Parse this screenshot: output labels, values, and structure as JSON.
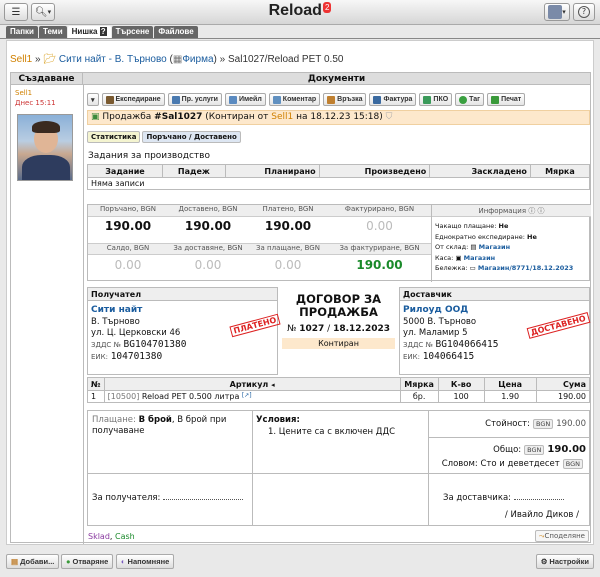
{
  "app": {
    "title": "Reload",
    "notification_count": "2"
  },
  "tabs": [
    {
      "label": "Папки"
    },
    {
      "label": "Теми"
    },
    {
      "label": "Нишка"
    },
    {
      "label": "?"
    },
    {
      "label": "Търсене"
    },
    {
      "label": "Файлове"
    }
  ],
  "breadcrumb": {
    "root": "Sell1",
    "sep1": "»",
    "company": "Сити найт - В. Търново",
    "company_type": "Фирма",
    "sep2": "»",
    "current": "Sal1027/Reload PET 0.50"
  },
  "columns": {
    "creator": "Създаване",
    "documents": "Документи"
  },
  "creator": {
    "name": "Sell1",
    "date": "Днес 15:11"
  },
  "actions": [
    {
      "label": "Експедиране",
      "color": "#7a5a30"
    },
    {
      "label": "Пр. услуги",
      "color": "#4a7ab0"
    },
    {
      "label": "Имейл",
      "color": "#5a8ac0"
    },
    {
      "label": "Коментар",
      "color": "#6090c0"
    },
    {
      "label": "Връзка",
      "color": "#c08030"
    },
    {
      "label": "Фактура",
      "color": "#3a6aa0"
    },
    {
      "label": "ПКО",
      "color": "#3a9a5a"
    },
    {
      "label": "Таг",
      "color": "#3aa040"
    },
    {
      "label": "Печат",
      "color": "#3a9a3a"
    }
  ],
  "sale": {
    "prefix": "Продажба",
    "id": "#Sal1027",
    "status_open": "(Контиран от",
    "author": "Sell1",
    "date_text": "на 18.12.23 15:18)"
  },
  "subtabs": [
    {
      "label": "Статистика"
    },
    {
      "label": "Поръчано / Доставено"
    }
  ],
  "production": {
    "title": "Задания за производство",
    "headers": [
      "Задание",
      "Падеж",
      "Планирано",
      "Произведено",
      "Заскладено",
      "Мярка"
    ],
    "empty": "Няма записи"
  },
  "finance": {
    "row1": [
      {
        "label": "Поръчано, BGN",
        "value": "190.00"
      },
      {
        "label": "Доставено, BGN",
        "value": "190.00"
      },
      {
        "label": "Платено, BGN",
        "value": "190.00"
      },
      {
        "label": "Фактурирано, BGN",
        "value": "0.00"
      }
    ],
    "row2": [
      {
        "label": "Салдо, BGN",
        "value": "0.00"
      },
      {
        "label": "За доставяне, BGN",
        "value": "0.00"
      },
      {
        "label": "За плащане, BGN",
        "value": "0.00"
      },
      {
        "label": "За фактуриране, BGN",
        "value": "190.00"
      }
    ],
    "info_title": "Информация",
    "info": [
      {
        "key": "Чакащо плащане:",
        "val": "Не"
      },
      {
        "key": "Еднократно експедиране:",
        "val": "Не"
      },
      {
        "key": "От склад:",
        "val": "Магазин"
      },
      {
        "key": "Каса:",
        "val": "Магазин"
      },
      {
        "key": "Бележка:",
        "val": "Магазин/8771/18.12.2023"
      }
    ]
  },
  "customer": {
    "header": "Получател",
    "name": "Сити найт",
    "city": "В. Търново",
    "address": "ул. Ц. Церковски 46",
    "vat_label": "ЗДДС №",
    "vat": "BG104701380",
    "eik_label": "ЕИК:",
    "eik": "104701380",
    "stamp": "ПЛАТЕНО"
  },
  "contract": {
    "title": "ДОГОВОР ЗА ПРОДАЖБА",
    "num_label": "№",
    "number": "1027",
    "date": "18.12.2023",
    "status": "Контиран"
  },
  "supplier": {
    "header": "Доставчик",
    "name": "Рилоуд ООД",
    "city": "5000 В. Търново",
    "address": "ул. Маламир 5",
    "vat_label": "ЗДДС №",
    "vat": "BG104066415",
    "eik_label": "ЕИК:",
    "eik": "104066415",
    "stamp": "ДОСТАВЕНО"
  },
  "items": {
    "headers": [
      "№",
      "Артикул",
      "Мярка",
      "К-во",
      "Цена",
      "Сума"
    ],
    "rows": [
      {
        "num": "1",
        "code": "[10500]",
        "name": "Reload PET 0.500 литра",
        "ext": "[↗]",
        "unit": "бр.",
        "qty": "100",
        "price": "1.90",
        "sum": "190.00"
      }
    ]
  },
  "payment": {
    "label": "Плащане:",
    "method": "В брой",
    "rest": ", В брой при получаване"
  },
  "conditions": {
    "title": "Условия:",
    "items": [
      "1. Цените са с включен ДДС"
    ]
  },
  "totals": {
    "value_label": "Стойност:",
    "value_cur": "BGN",
    "value": "190.00",
    "total_label": "Общо:",
    "total_cur": "BGN",
    "total": "190.00",
    "words_label": "Словом:",
    "words": "Сто и деветдесет",
    "words_cur": "BGN"
  },
  "signatures": {
    "recipient_label": "За получателя:",
    "supplier_label": "За доставчика:",
    "supplier_name": "/ Ивайло Диков /"
  },
  "footer": {
    "link1": "Sklad",
    "link2": "Cash",
    "share": "Споделяне"
  },
  "bottom_bar": {
    "add": "Добави...",
    "open": "Отваряне",
    "reminder": "Напомняне",
    "settings": "Настройки"
  }
}
